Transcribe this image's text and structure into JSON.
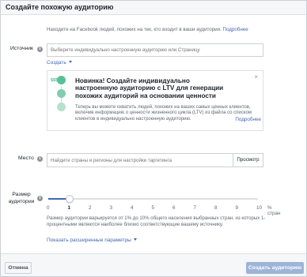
{
  "dialog": {
    "title": "Создайте похожую аудиторию"
  },
  "intro": {
    "text": "Находите на Facebook людей, похожих на тех, кто входит в ваши аудитории.",
    "link": "Подробнее"
  },
  "source": {
    "label": "Источник",
    "placeholder": "Выберите индивидуально настроенную аудиторию или Страницу",
    "create_link": "Создать"
  },
  "promo": {
    "headline": "Новинка! Создайте индивидуально настроенную аудиторию с LTV для генерации похожих аудиторий на основании ценности",
    "body": "Теперь вы можете охватить людей, похожих на ваших самых ценных клиентов, включив информацию о ценности жизненного цикла (LTV) из файла со списком клиентов в индивидуально настроенную аудиторию.",
    "link": "Подробнее",
    "close_icon": "close-icon",
    "illustration_dollar": "$$$",
    "colors": {
      "top": "#58c097",
      "mid": "#7fcfae",
      "low": "#b3e2cd"
    }
  },
  "location": {
    "label": "Место",
    "placeholder": "Найдите страны и регионы для настройки таргетинга",
    "browse_label": "Просмотр"
  },
  "audience_size": {
    "label": "Размер аудитории",
    "ticks": [
      "0",
      "1",
      "2",
      "3",
      "4",
      "5",
      "6",
      "7",
      "8",
      "9",
      "10"
    ],
    "unit": "% стран",
    "selected": 1,
    "min": 0,
    "max": 10,
    "description": "Размер аудитории варьируется от 1% до 10% общего населения выбранных стран, из которых 1-процентными являются наиболее близко соответствующие вашему источнику."
  },
  "advanced": {
    "label": "Показать расширенные параметры"
  },
  "footer": {
    "cancel_label": "Отмена",
    "create_label": "Создать аудиторию"
  },
  "colors": {
    "accent": "#4267b2",
    "disabled_button": "#9cb4d8"
  }
}
